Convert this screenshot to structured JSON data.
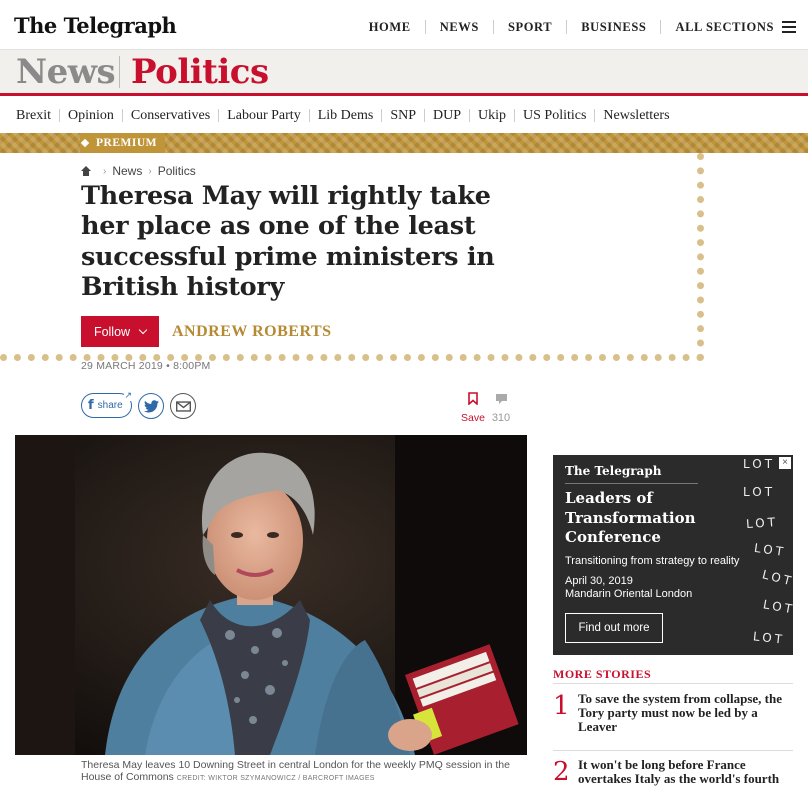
{
  "header": {
    "logo": "The Telegraph",
    "nav": [
      "HOME",
      "NEWS",
      "SPORT",
      "BUSINESS",
      "ALL SECTIONS"
    ]
  },
  "section": {
    "primary": "News",
    "secondary": "Politics"
  },
  "subnav": [
    "Brexit",
    "Opinion",
    "Conservatives",
    "Labour Party",
    "Lib Dems",
    "SNP",
    "DUP",
    "Ukip",
    "US Politics",
    "Newsletters"
  ],
  "premium_label": "PREMIUM",
  "breadcrumb": [
    "News",
    "Politics"
  ],
  "article": {
    "headline": "Theresa May will rightly take her place as one of the least successful prime ministers in British history",
    "follow_label": "Follow",
    "author": "ANDREW ROBERTS",
    "date": "29 MARCH 2019 • 8:00PM",
    "share_label": "share",
    "save_label": "Save",
    "comment_count": "310",
    "caption": "Theresa May leaves 10 Downing Street in central London for the weekly PMQ session in the House of Commons",
    "credit": "CREDIT: WIKTOR SZYMANOWICZ / BARCROFT IMAGES"
  },
  "ad": {
    "logo": "The Telegraph",
    "title": "Leaders of Transformation Conference",
    "subtitle": "Transitioning from strategy to reality",
    "date": "April 30, 2019",
    "venue": "Mandarin Oriental London",
    "cta": "Find out more",
    "brand_repeat": "LOT",
    "close": "×"
  },
  "more_stories": {
    "heading": "MORE STORIES",
    "items": [
      {
        "num": "1",
        "title": "To save the system from collapse, the Tory party must now be led by a Leaver"
      },
      {
        "num": "2",
        "title": "It won't be long before France overtakes Italy as the world's fourth"
      }
    ]
  },
  "colors": {
    "brand_red": "#c8102e",
    "premium_gold": "#c0953a",
    "author_gold": "#b58a33",
    "link_blue": "#2d6aa7"
  }
}
